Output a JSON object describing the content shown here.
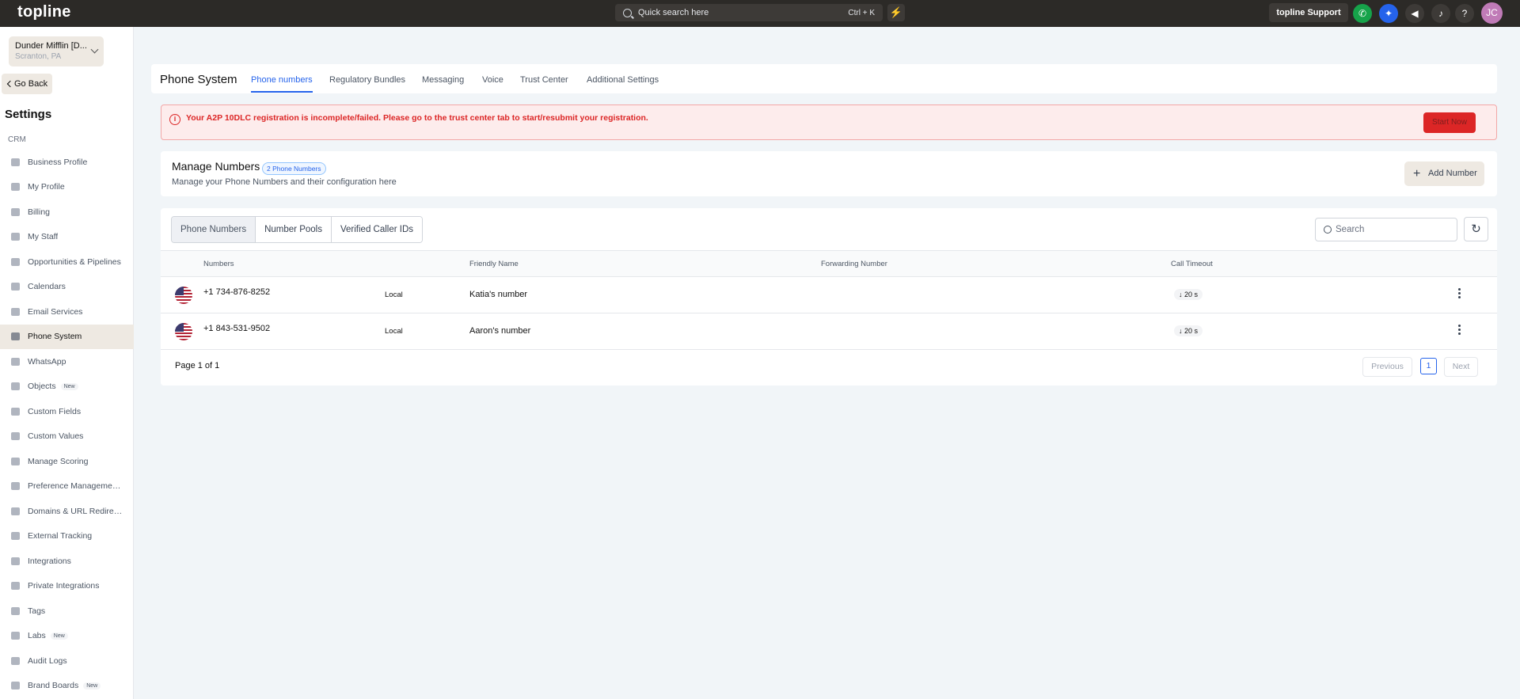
{
  "topbar": {
    "logo": "topline",
    "search_placeholder": "Quick search here",
    "search_shortcut": "Ctrl + K",
    "support_label": "topline Support",
    "avatar_initials": "JC"
  },
  "sidebar": {
    "location_name": "Dunder Mifflin [D...",
    "location_city": "Scranton, PA",
    "go_back": "Go Back",
    "title": "Settings",
    "section": "CRM",
    "items": [
      {
        "label": "Business Profile"
      },
      {
        "label": "My Profile"
      },
      {
        "label": "Billing"
      },
      {
        "label": "My Staff"
      },
      {
        "label": "Opportunities & Pipelines"
      },
      {
        "label": "Calendars"
      },
      {
        "label": "Email Services"
      },
      {
        "label": "Phone System"
      },
      {
        "label": "WhatsApp"
      },
      {
        "label": "Objects",
        "badge": "New"
      },
      {
        "label": "Custom Fields"
      },
      {
        "label": "Custom Values"
      },
      {
        "label": "Manage Scoring"
      },
      {
        "label": "Preference Managemen..."
      },
      {
        "label": "Domains & URL Redirects"
      },
      {
        "label": "External Tracking"
      },
      {
        "label": "Integrations"
      },
      {
        "label": "Private Integrations"
      },
      {
        "label": "Tags"
      },
      {
        "label": "Labs",
        "badge": "New"
      },
      {
        "label": "Audit Logs"
      },
      {
        "label": "Brand Boards",
        "badge": "New"
      }
    ]
  },
  "header": {
    "title": "Phone System",
    "tabs": [
      "Phone numbers",
      "Regulatory Bundles",
      "Messaging",
      "Voice",
      "Trust Center",
      "Additional Settings"
    ]
  },
  "alert": {
    "text": "Your A2P 10DLC registration is incomplete/failed. Please go to the trust center tab to start/resubmit your registration.",
    "button": "Start Now"
  },
  "manage": {
    "title": "Manage Numbers",
    "count_badge": "2 Phone Numbers",
    "subtitle": "Manage your Phone Numbers and their configuration here",
    "add_button": "Add Number"
  },
  "table": {
    "segments": [
      "Phone Numbers",
      "Number Pools",
      "Verified Caller IDs"
    ],
    "search_placeholder": "Search",
    "columns": [
      "Numbers",
      "Friendly Name",
      "Forwarding Number",
      "Call Timeout"
    ],
    "rows": [
      {
        "number": "+1 734-876-8252",
        "type": "Local",
        "friendly_name": "Katia's number",
        "forwarding": "",
        "timeout": "20 s"
      },
      {
        "number": "+1 843-531-9502",
        "type": "Local",
        "friendly_name": "Aaron's number",
        "forwarding": "",
        "timeout": "20 s"
      }
    ],
    "page_info": "Page 1 of 1",
    "prev": "Previous",
    "page_num": "1",
    "next": "Next"
  }
}
